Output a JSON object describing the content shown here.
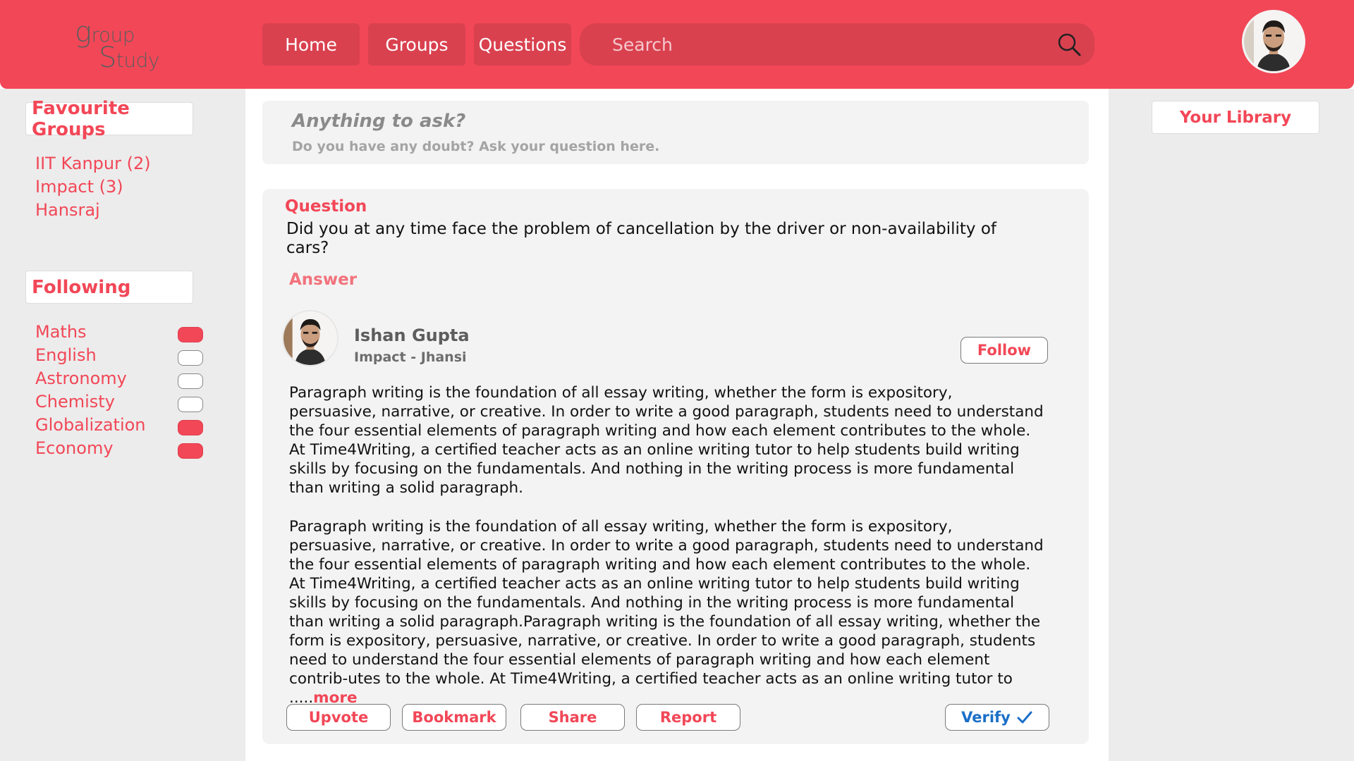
{
  "header": {
    "logo_big_1": "g",
    "logo_rest_1": "roup",
    "logo_big_2": "S",
    "logo_rest_2": "tudy",
    "nav": [
      {
        "label": "Home"
      },
      {
        "label": "Groups"
      },
      {
        "label": "Questions"
      }
    ],
    "search_placeholder": "Search"
  },
  "left_sidebar": {
    "favourite_title": "Favourite Groups",
    "favourite_groups": [
      "IIT Kanpur (2)",
      "Impact (3)",
      "Hansraj"
    ],
    "following_title": "Following",
    "following": [
      {
        "label": "Maths",
        "on": true
      },
      {
        "label": "English",
        "on": false
      },
      {
        "label": "Astronomy",
        "on": false
      },
      {
        "label": "Chemisty",
        "on": false
      },
      {
        "label": "Globalization",
        "on": true
      },
      {
        "label": "Economy",
        "on": true
      }
    ]
  },
  "ask": {
    "title": "Anything to ask?",
    "subtitle": "Do you have any doubt? Ask your question here."
  },
  "question": {
    "label": "Question",
    "text": "Did you at any time face the problem of cancellation by the driver or non-availability of cars?",
    "answer_label": "Answer",
    "author": {
      "name": "Ishan Gupta",
      "meta": "Impact - Jhansi",
      "follow_label": "Follow"
    },
    "para1": "Paragraph writing is the foundation of all essay writing, whether the form is expository, persuasive, narrative, or creative. In order to write a good paragraph, students need to understand the four essential elements of paragraph writing and how each element contributes to the whole. At Time4Writing, a certified teacher acts as an online writing tutor to help students build writing skills by focusing on the fundamentals. And nothing in the writing process is more fundamental than writing a solid paragraph.",
    "para2": "Paragraph writing is the foundation of all essay writing, whether the form is expository, persuasive, narrative, or creative. In order to write a good paragraph, students need to understand the four essential elements of paragraph writing and how each element contributes to the whole. At Time4Writing, a certified teacher acts as an online writing tutor to help students build writing skills by focusing on the fundamentals. And nothing in the writing process is more fundamental than writing a solid paragraph.Paragraph writing is the foundation of all essay writing, whether the form is expository, persuasive, narrative, or creative. In order to write a good paragraph, students need to understand the four essential elements of paragraph writing and how each element contrib-utes to the whole. At Time4Writing, a certified teacher acts as an online writing tutor to .....",
    "more_label": "more",
    "actions": {
      "upvote": "Upvote",
      "bookmark": "Bookmark",
      "share": "Share",
      "report": "Report",
      "verify": "Verify"
    }
  },
  "right_sidebar": {
    "library_label": "Your Library"
  },
  "colors": {
    "brand": "#f24757",
    "brand_dark": "#d9414f",
    "verify": "#1b6fc8"
  }
}
